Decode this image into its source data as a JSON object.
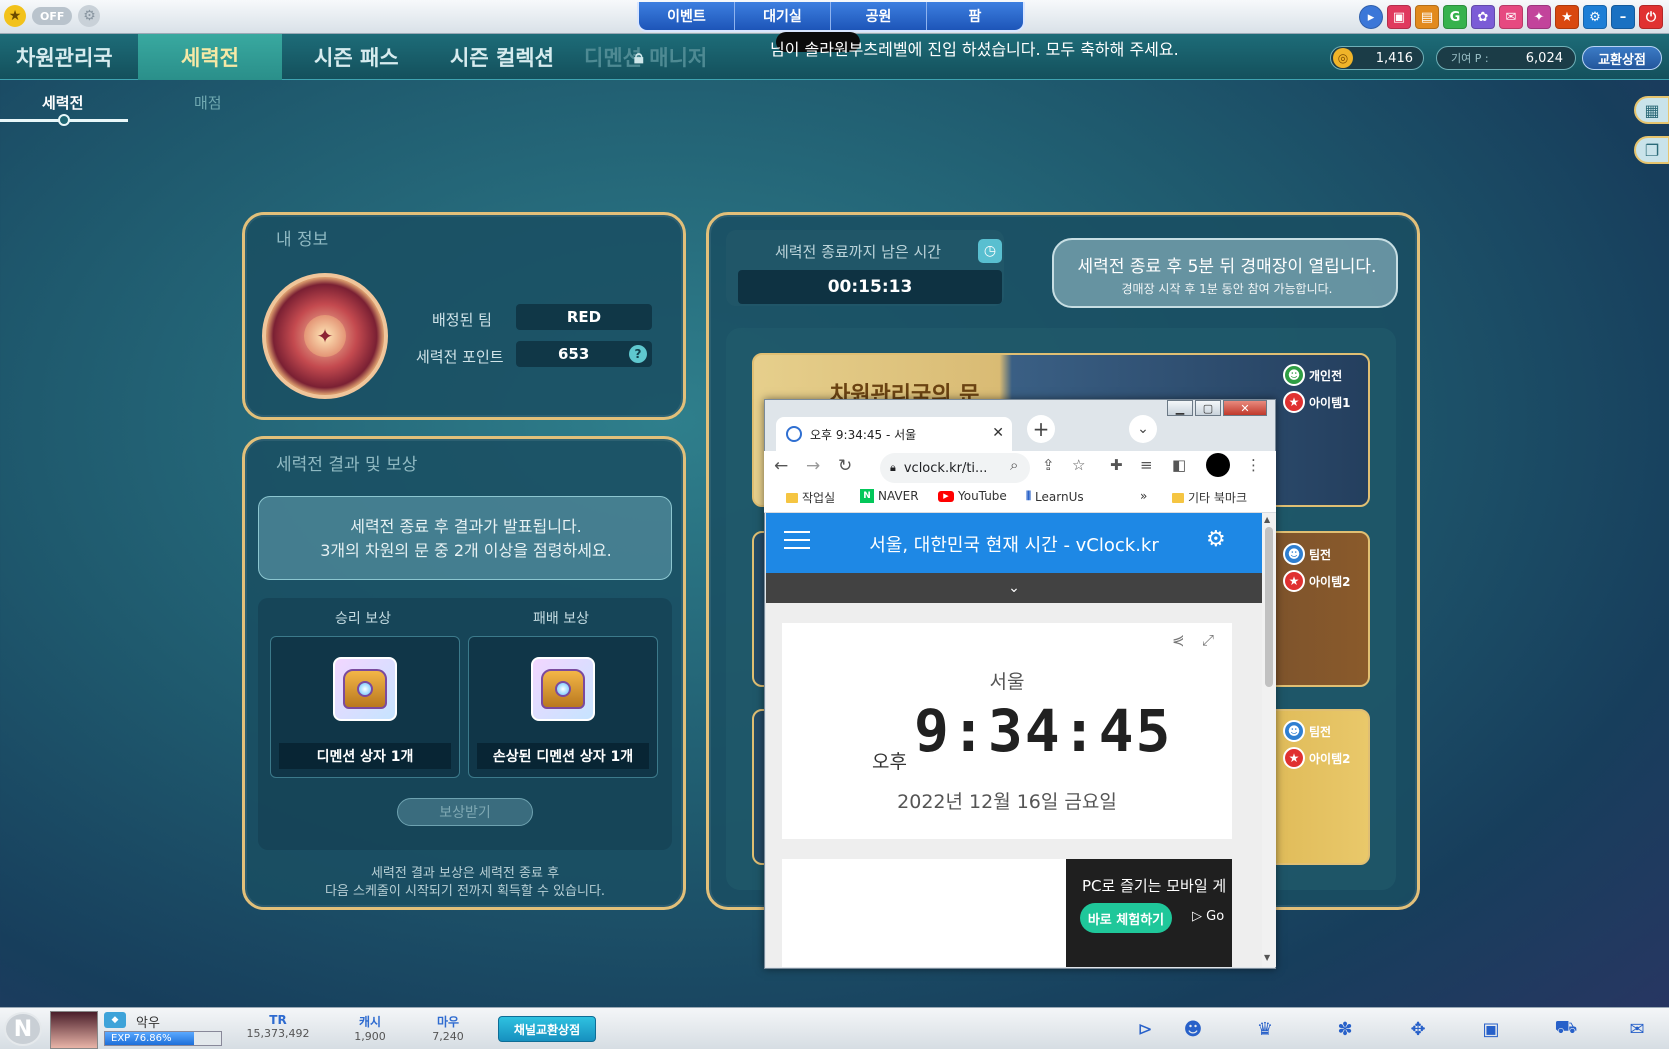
{
  "topbar": {
    "off_label": "OFF",
    "tabs": [
      "이벤트",
      "대기실",
      "공원",
      "팜"
    ]
  },
  "nav": {
    "items": [
      "차원관리국",
      "세력전",
      "시즌 패스",
      "시즌 컬렉션",
      "디멘션 매니저"
    ],
    "ticker": "님이 솔라원부츠레벨에 진입 하셨습니다. 모두 축하해 주세요.",
    "currency1": "1,416",
    "currency2_label": "기여 P :",
    "currency2": "6,024",
    "exchange_label": "교환상점"
  },
  "subnav": {
    "active": "세력전",
    "other": "매점"
  },
  "my_info": {
    "title": "내 정보",
    "team_label": "배정된 팀",
    "team_value": "RED",
    "points_label": "세력전 포인트",
    "points_value": "653",
    "help_glyph": "?"
  },
  "results": {
    "title": "세력전 결과 및 보상",
    "notice_line1": "세력전 종료 후 결과가 발표됩니다.",
    "notice_line2": "3개의 차원의 문 중 2개 이상을 점령하세요.",
    "win_head": "승리 보상",
    "lose_head": "패배 보상",
    "win_item": "디멘션 상자 1개",
    "lose_item": "손상된 디멘션 상자 1개",
    "claim_label": "보상받기",
    "foot_line1": "세력전 결과 보상은 세력전 종료 후",
    "foot_line2": "다음 스케줄이 시작되기 전까지 획득할 수 있습니다."
  },
  "timer": {
    "label": "세력전 종료까지 남은 시간",
    "value": "00:15:13",
    "auction_main": "세력전 종료 후 5분 뒤 경매장이 열립니다.",
    "auction_sub": "경매장 시작 후 1분 동안 참여 가능합니다."
  },
  "doors": {
    "title": "차원관리국의 문",
    "cards": [
      {
        "mode": "개인전",
        "item": "아이템1"
      },
      {
        "mode": "팀전",
        "item": "아이템2"
      },
      {
        "mode": "팀전",
        "item": "아이템2"
      }
    ]
  },
  "browser": {
    "tab_title": "오후 9:34:45 - 서울",
    "url": "vclock.kr/ti...",
    "bookmarks": [
      "작업실",
      "NAVER",
      "YouTube",
      "LearnUs",
      "»",
      "기타 북마크"
    ],
    "page_title": "서울, 대한민국 현재 시간 - vClock.kr",
    "city": "서울",
    "ampm": "오후",
    "time": "9:34:45",
    "date": "2022년 12월 16일 금요일",
    "ad_text": "PC로 즐기는 모바일 게",
    "ad_button": "바로 체험하기",
    "ad_go": "Go"
  },
  "bottombar": {
    "name": "악우",
    "exp": "EXP 76.86%",
    "exp_fraction": 0.7686,
    "stats": [
      {
        "label": "TR",
        "value": "15,373,492"
      },
      {
        "label": "캐시",
        "value": "1,900"
      },
      {
        "label": "마우",
        "value": "7,240"
      }
    ],
    "channel_button": "채널교환상점"
  }
}
